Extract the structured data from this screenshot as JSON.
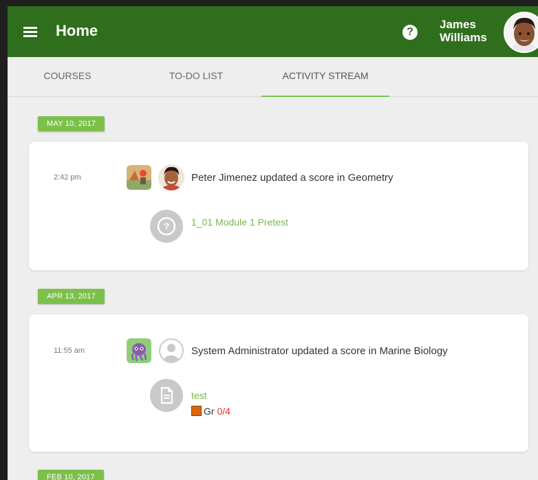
{
  "header": {
    "title": "Home",
    "user_first": "James",
    "user_last": "Williams",
    "help_glyph": "?",
    "brand_color": "#2f6e1c"
  },
  "tabs": [
    {
      "label": "COURSES",
      "active": false
    },
    {
      "label": "TO-DO LIST",
      "active": false
    },
    {
      "label": "ACTIVITY STREAM",
      "active": true
    }
  ],
  "stream": [
    {
      "date": "MAY 10, 2017",
      "time": "2:42 pm",
      "course_icon": "geometry-course-icon",
      "text": "Peter Jimenez updated a score in Geometry",
      "item_icon": "question-icon",
      "item_title": "1_01 Module 1 Pretest"
    },
    {
      "date": "APR 13, 2017",
      "time": "11:55 am",
      "course_icon": "marine-biology-course-icon",
      "text": "System Administrator updated a score in Marine Biology",
      "item_icon": "document-icon",
      "item_title": "test",
      "grade_label": "Gr",
      "grade_value": "0/4"
    }
  ],
  "next_date": "FEB 10, 2017",
  "accent_color": "#7cc04a"
}
